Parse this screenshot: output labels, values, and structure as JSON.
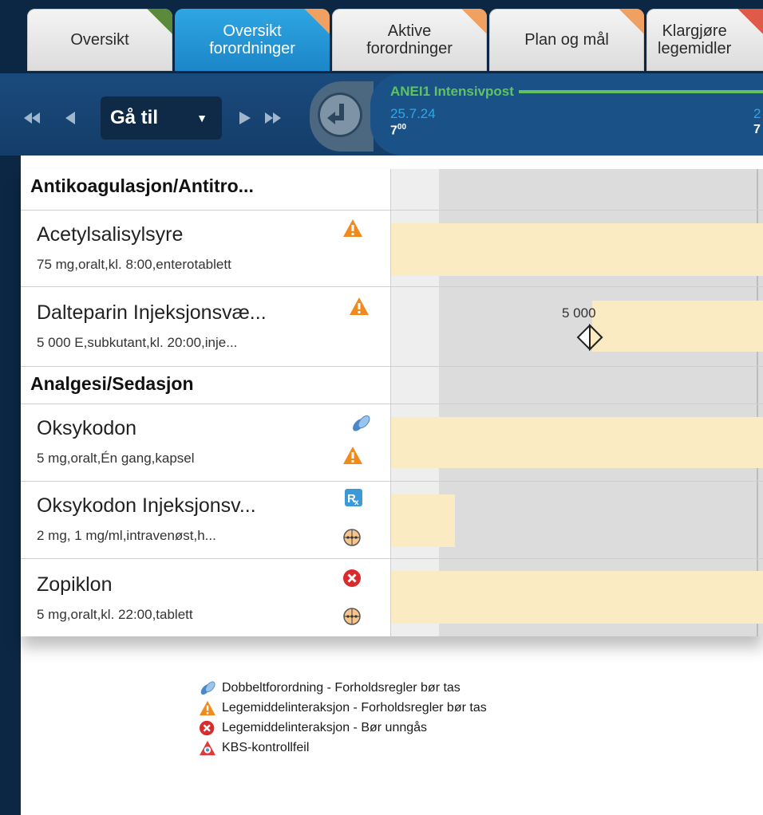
{
  "tabs": [
    {
      "label": "Oversikt",
      "active": false,
      "corner_color": "#5a8a3a"
    },
    {
      "label": "Oversikt\nforordninger",
      "active": true,
      "corner_color": "#f0a060"
    },
    {
      "label": "Aktive\nforordninger",
      "active": false,
      "corner_color": "#f0a060"
    },
    {
      "label": "Plan og mål",
      "active": false,
      "corner_color": "#f0a060"
    },
    {
      "label": "Klargjøre\nlegemidler",
      "active": false,
      "corner_color": "#e05a4a"
    }
  ],
  "nav": {
    "goto_label": "Gå til",
    "icons": [
      "rewind-icon",
      "back-icon",
      "chevron-down-icon",
      "forward-icon",
      "fast-forward-icon",
      "return-arrow-icon"
    ]
  },
  "timeline": {
    "location": "ANEI1 Intensivpost",
    "date": "25.7.24",
    "time_hour": "7",
    "time_min": "00",
    "date2_partial": "2",
    "time2_partial": "7"
  },
  "sections": [
    {
      "title": "Antikoagulasjon/Antitro...",
      "drugs": [
        {
          "name": "Acetylsalisylsyre",
          "detail": "75 mg,oralt,kl. 8:00,enterotablett",
          "icons": [
            "warning-icon"
          ]
        },
        {
          "name": "Dalteparin Injeksjonsvæ...",
          "detail": "5 000 E,subkutant,kl. 20:00,inje...",
          "icons": [
            "warning-icon"
          ],
          "dose_marker": "5 000"
        }
      ]
    },
    {
      "title": "Analgesi/Sedasjon",
      "drugs": [
        {
          "name": "Oksykodon",
          "detail": "5 mg,oralt,Én gang,kapsel",
          "icons": [
            "double-pill-icon",
            "warning-icon"
          ]
        },
        {
          "name": "Oksykodon Injeksjonsv...",
          "detail": "2 mg, 1 mg/ml,intravenøst,h...",
          "icons": [
            "rx-icon",
            "prn-icon"
          ]
        },
        {
          "name": "Zopiklon",
          "detail": "5 mg,oralt,kl. 22:00,tablett",
          "icons": [
            "stop-icon",
            "prn-icon"
          ]
        }
      ]
    }
  ],
  "legend": [
    {
      "icon": "double-pill-icon",
      "text": "Dobbeltforordning - Forholdsregler bør tas"
    },
    {
      "icon": "warning-icon",
      "text": "Legemiddelinteraksjon - Forholdsregler bør tas"
    },
    {
      "icon": "stop-icon",
      "text": "Legemiddelinteraksjon - Bør unngås"
    },
    {
      "icon": "kbs-error-icon",
      "text": "KBS-kontrollfeil"
    }
  ],
  "colors": {
    "navy": "#0b2744",
    "tab_active": "#1b86c8",
    "timeline_green": "#5fc35f",
    "timeline_blue": "#2fa6e3",
    "warning_orange": "#f08a1c",
    "stop_red": "#d92b2b",
    "administration_band": "#fbebc3"
  }
}
